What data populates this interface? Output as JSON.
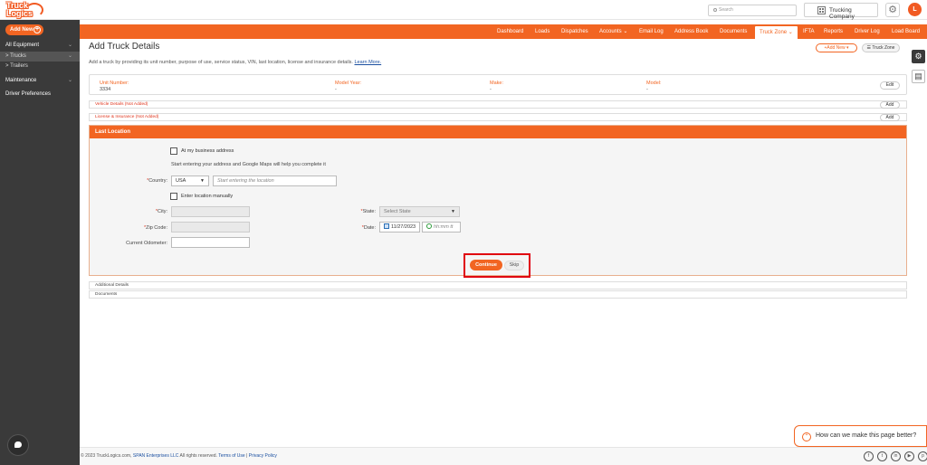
{
  "brand": {
    "line1": "Truck",
    "line2": "Logics",
    "accent": "#f26522"
  },
  "header": {
    "search_placeholder": "Search",
    "company": "Trucking Company",
    "avatar_letter": "L"
  },
  "nav": [
    "Dashboard",
    "Loads",
    "Dispatches",
    "Accounts ⌄",
    "Email Log",
    "Address Book",
    "Documents",
    "Truck Zone ⌄",
    "IFTA",
    "Reports",
    "Driver Log",
    "Load Board"
  ],
  "sidebar": {
    "add_new": "Add New",
    "items": [
      {
        "label": "All Equipment",
        "chev": "⌄"
      },
      {
        "label": "> Trucks",
        "chev": "⌄"
      },
      {
        "label": "> Trailers",
        "chev": ""
      },
      {
        "label": "Maintenance",
        "chev": "⌄"
      },
      {
        "label": "Driver Preferences",
        "chev": ""
      }
    ]
  },
  "page": {
    "title": "Add Truck Details",
    "subtitle": "Add a truck by providing its unit number, purpose of use, service status, VIN, last location, license and insurance details.",
    "learn_more": "Learn More.",
    "add_new_btn": "+Add New ▾",
    "truck_zone_btn": "☰ Truck Zone"
  },
  "unit": {
    "labels": [
      "Unit Number:",
      "Model Year:",
      "Make:",
      "Model:"
    ],
    "values": [
      "3334",
      "-",
      "-",
      "-"
    ],
    "edit": "Edit"
  },
  "sections": {
    "vehicle": "Vehicle Details (Not Added)",
    "license": "License & Insurance (Not Added)",
    "add": "Add"
  },
  "location": {
    "header": "Last Location",
    "at_business": "At my business address",
    "hint": "Start entering your address and Google Maps will help you complete it",
    "country_label": "Country:",
    "country_value": "USA",
    "location_placeholder": "Start entering the location",
    "manual": "Enter location manually",
    "city_label": "City:",
    "zip_label": "Zip Code:",
    "odometer_label": "Current Odometer:",
    "state_label": "State:",
    "state_value": "Select State",
    "date_label": "Date:",
    "date_value": "11/27/2023",
    "time_placeholder": "hh:mm tt",
    "continue": "Continue",
    "skip": "Skip"
  },
  "collapsed": {
    "additional": "Additional Details",
    "documents": "Documents"
  },
  "feedback": "How can we make this page better?",
  "footer": {
    "prefix": "© 2023 TruckLogics.com,",
    "company_link": "SPAN Enterprises LLC",
    "rights": "All rights reserved.",
    "terms": "Terms of Use",
    "sep": "|",
    "privacy": "Privacy Policy",
    "social": [
      "f",
      "t",
      "in",
      "▶",
      "p"
    ]
  }
}
